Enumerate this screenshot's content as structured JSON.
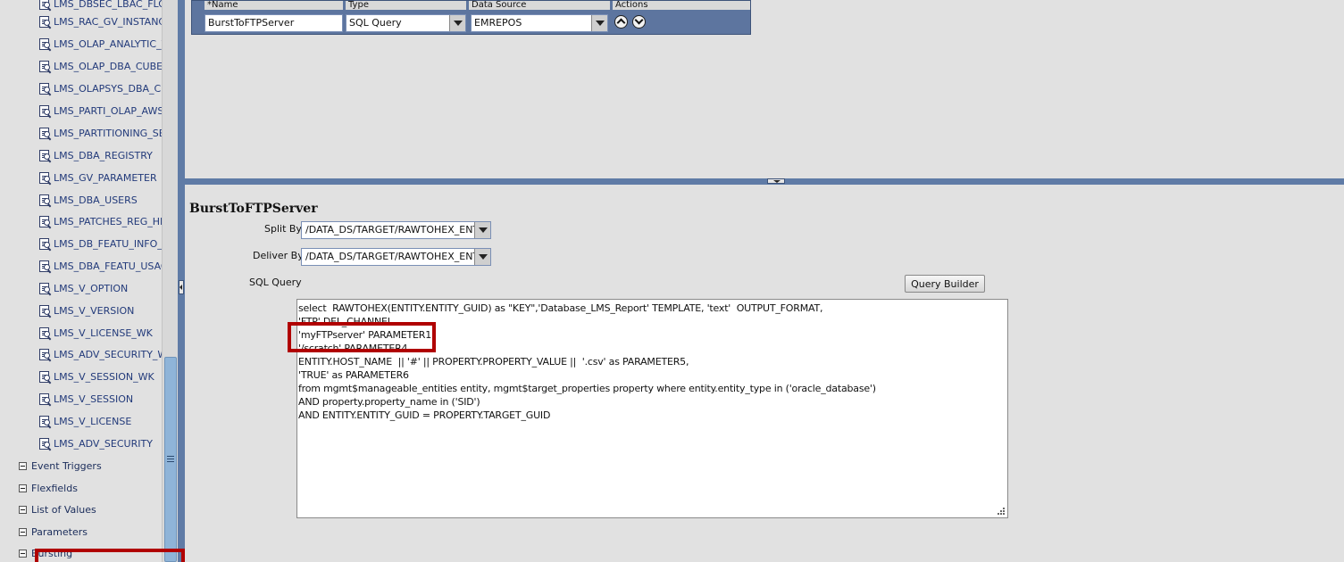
{
  "tree": {
    "items": [
      "LMS_DBSEC_LBAC_FLO",
      "LMS_RAC_GV_INSTANC",
      "LMS_OLAP_ANALYTIC_V",
      "LMS_OLAP_DBA_CUBES",
      "LMS_OLAPSYS_DBA_C",
      "LMS_PARTI_OLAP_AWS",
      "LMS_PARTITIONING_SEG",
      "LMS_DBA_REGISTRY",
      "LMS_GV_PARAMETER",
      "LMS_DBA_USERS",
      "LMS_PATCHES_REG_HIS",
      "LMS_DB_FEATU_INFO_U",
      "LMS_DBA_FEATU_USAG",
      "LMS_V_OPTION",
      "LMS_V_VERSION",
      "LMS_V_LICENSE_WK",
      "LMS_ADV_SECURITY_W",
      "LMS_V_SESSION_WK",
      "LMS_V_SESSION",
      "LMS_V_LICENSE",
      "LMS_ADV_SECURITY"
    ],
    "groups": [
      "Event Triggers",
      "Flexfields",
      "List of Values",
      "Parameters",
      "Bursting"
    ]
  },
  "grid": {
    "headers": {
      "name": "*Name",
      "type": "Type",
      "data_source": "Data Source",
      "actions": "Actions"
    },
    "row": {
      "name": "BurstToFTPServer",
      "type": "SQL Query",
      "data_source": "EMREPOS"
    }
  },
  "detail": {
    "title": "BurstToFTPServer",
    "split_by_label": "Split By",
    "split_by_value": "/DATA_DS/TARGET/RAWTOHEX_ENTITY",
    "deliver_by_label": "Deliver By",
    "deliver_by_value": "/DATA_DS/TARGET/RAWTOHEX_ENTITY",
    "sql_query_label": "SQL Query",
    "query_builder_label": "Query Builder",
    "sql_lines": [
      "select  RAWTOHEX(ENTITY.ENTITY_GUID) as \"KEY\",'Database_LMS_Report' TEMPLATE, 'text'  OUTPUT_FORMAT,",
      "'FTP' DEL_CHANNEL,",
      "'myFTPserver' PARAMETER1,",
      "'/scratch' PARAMETER4,",
      "ENTITY.HOST_NAME  || '#' || PROPERTY.PROPERTY_VALUE ||  '.csv' as PARAMETER5,",
      "'TRUE' as PARAMETER6",
      "from mgmt$manageable_entities entity, mgmt$target_properties property where entity.entity_type in ('oracle_database')",
      "AND property.property_name in ('SID')",
      "AND ENTITY.ENTITY_GUID = PROPERTY.TARGET_GUID"
    ]
  },
  "colors": {
    "accent": "#5f7ba6",
    "annotation": "#b00000",
    "link": "#223a7a"
  }
}
